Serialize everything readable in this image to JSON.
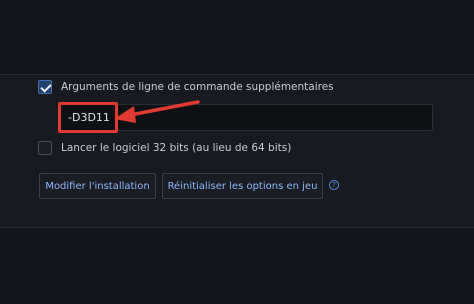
{
  "settings": {
    "extra_args": {
      "checked": true,
      "label": "Arguments de ligne de commande supplémentaires",
      "value": "-D3D11"
    },
    "run_32bit": {
      "checked": false,
      "label": "Lancer le logiciel 32 bits (au lieu de 64 bits)"
    },
    "buttons": {
      "modify": "Modifier l'installation",
      "reset": "Réinitialiser les options en jeu"
    },
    "help_icon": "question-circle-icon",
    "help_symbol": "?"
  },
  "annotation": {
    "color": "#e13a32",
    "icon": "arrow-left-icon"
  },
  "colors": {
    "accent": "#3e6fb3",
    "link": "#8fb7ff",
    "background": "#15171d"
  }
}
